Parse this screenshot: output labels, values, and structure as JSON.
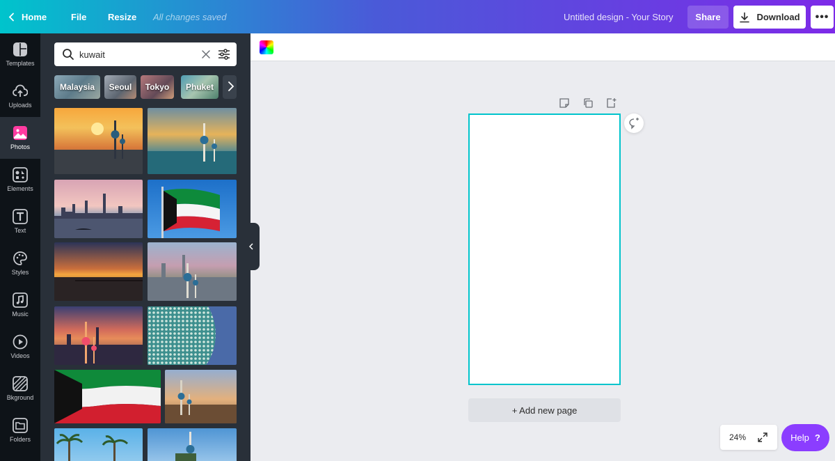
{
  "topbar": {
    "home_label": "Home",
    "file_label": "File",
    "resize_label": "Resize",
    "saved_status": "All changes saved",
    "design_title": "Untitled design - Your Story",
    "share_label": "Share",
    "download_label": "Download",
    "more_label": "•••"
  },
  "rail": {
    "items": [
      {
        "label": "Templates",
        "icon": "templates-icon"
      },
      {
        "label": "Uploads",
        "icon": "cloud-upload-icon"
      },
      {
        "label": "Photos",
        "icon": "photos-icon",
        "active": true
      },
      {
        "label": "Elements",
        "icon": "shapes-icon"
      },
      {
        "label": "Text",
        "icon": "text-icon"
      },
      {
        "label": "Styles",
        "icon": "palette-icon"
      },
      {
        "label": "Music",
        "icon": "music-note-icon"
      },
      {
        "label": "Videos",
        "icon": "play-icon"
      },
      {
        "label": "Bkground",
        "icon": "hatch-background-icon"
      },
      {
        "label": "Folders",
        "icon": "folder-icon"
      }
    ]
  },
  "panel": {
    "search_value": "kuwait",
    "chips": [
      "Malaysia",
      "Seoul",
      "Tokyo",
      "Phuket"
    ]
  },
  "canvas": {
    "add_page_label": "+ Add new page"
  },
  "zoom": {
    "value": "24%"
  },
  "help": {
    "label": "Help",
    "icon_text": "?"
  },
  "colors": {
    "accent_teal": "#00c4cc",
    "accent_purple": "#7d2ae8",
    "help_purple": "#8b3dff",
    "panel_bg": "#293039",
    "rail_bg": "#0e1318"
  }
}
